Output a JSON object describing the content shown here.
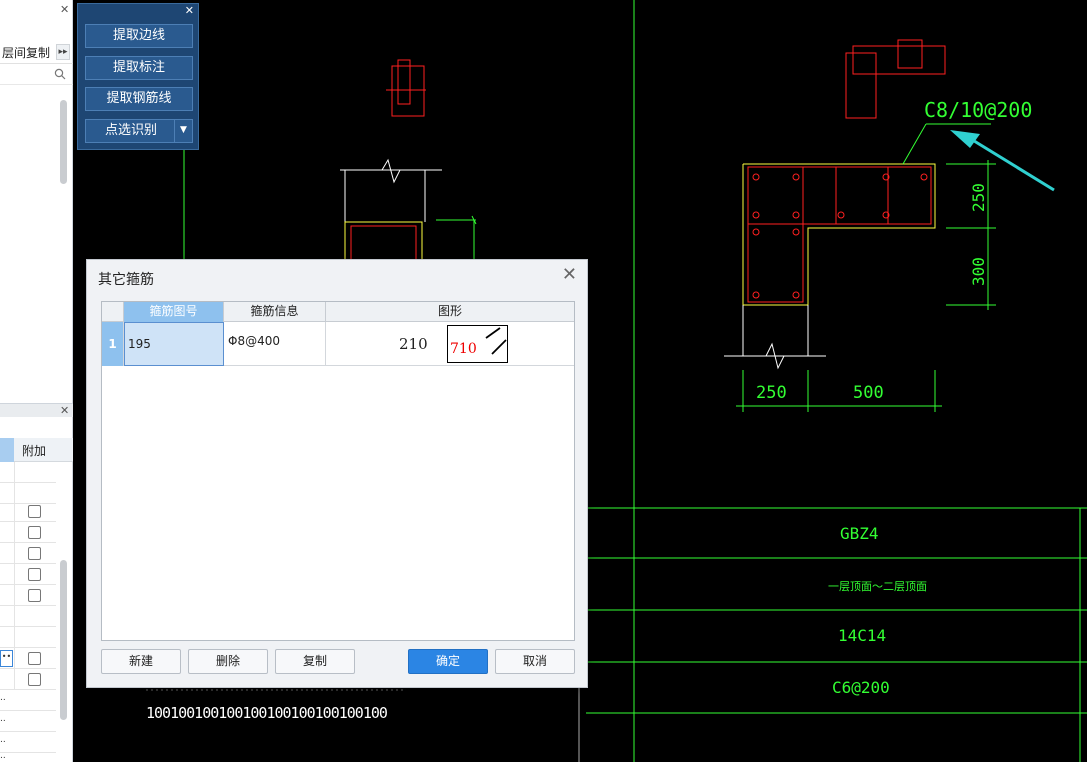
{
  "left_panel": {
    "floor_copy_label": "层间复制",
    "grid_header_label": "附加",
    "row_dots": [
      "..",
      "..",
      "..",
      ".."
    ]
  },
  "toolbar": {
    "buttons": [
      "提取边线",
      "提取标注",
      "提取钢筋线",
      "点选识别"
    ]
  },
  "cad": {
    "stirrup_label": "C8/10@200",
    "dim_250_v": "250",
    "dim_300_v": "300",
    "dim_250_h": "250",
    "dim_500_h": "500",
    "table_gbz": "GBZ4",
    "table_floor": "一层顶面～二层顶面",
    "table_rebar": "14C14",
    "table_stirrup": "C6@200",
    "dim_row": "100100100100100100100100100100"
  },
  "dialog": {
    "title": "其它箍筋",
    "columns": [
      "箍筋图号",
      "箍筋信息",
      "图形"
    ],
    "rows": [
      {
        "index": "1",
        "shape_no": "195",
        "info": "Φ8@400",
        "dim1": "210",
        "dim2": "710"
      }
    ],
    "buttons": {
      "new": "新建",
      "delete": "删除",
      "copy": "复制",
      "ok": "确定",
      "cancel": "取消"
    }
  },
  "colors": {
    "cad_green": "#33ff33",
    "rebar_red": "#ff2020",
    "outline_yellow": "#ffff40",
    "arrow_cyan": "#30d0d0",
    "primary_blue": "#2b85e4"
  }
}
